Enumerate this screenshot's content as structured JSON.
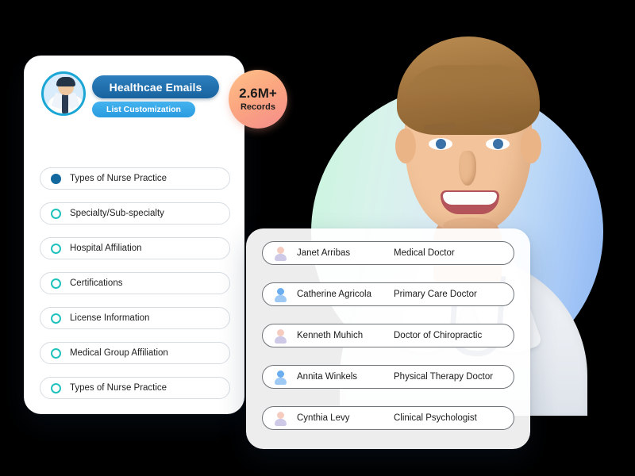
{
  "left_card": {
    "logo_icon": "doctor-avatar-icon",
    "title": "Healthcae Emails",
    "subtitle": "List Customization",
    "records_badge": {
      "value": "2.6M+",
      "label": "Records",
      "color": "#fba680"
    },
    "options": [
      {
        "label": "Types of Nurse Practice",
        "selected": true
      },
      {
        "label": "Specialty/Sub-specialty",
        "selected": false
      },
      {
        "label": "Hospital Affiliation",
        "selected": false
      },
      {
        "label": "Certifications",
        "selected": false
      },
      {
        "label": "License Information",
        "selected": false
      },
      {
        "label": "Medical Group Affiliation",
        "selected": false
      },
      {
        "label": "Types of Nurse Practice",
        "selected": false
      }
    ],
    "selected_color": "#13699e",
    "unselected_color": "#1fc2bd"
  },
  "right_card": {
    "contacts": [
      {
        "name": "Janet Arribas",
        "role": "Medical Doctor",
        "avatar": "person-icon-pink"
      },
      {
        "name": "Catherine Agricola",
        "role": "Primary Care Doctor",
        "avatar": "person-icon-blue"
      },
      {
        "name": "Kenneth Muhich",
        "role": "Doctor of Chiropractic",
        "avatar": "person-icon-pink"
      },
      {
        "name": "Annita Winkels",
        "role": "Physical Therapy Doctor",
        "avatar": "person-icon-blue"
      },
      {
        "name": "Cynthia Levy",
        "role": "Clinical Psychologist",
        "avatar": "person-icon-pink"
      }
    ]
  },
  "background": {
    "circle_gradient_start": "#c9f4dd",
    "circle_gradient_end": "#8ab4f3",
    "photo_alt": "smiling-doctor-photo"
  }
}
